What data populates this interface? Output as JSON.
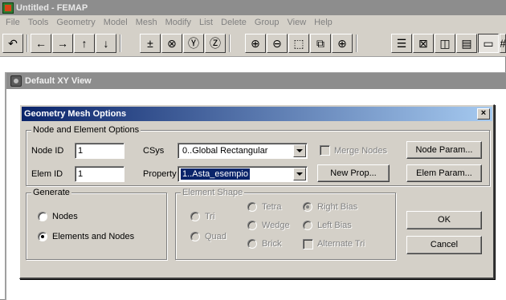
{
  "window": {
    "title": "Untitled - FEMAP"
  },
  "menu": [
    "File",
    "Tools",
    "Geometry",
    "Model",
    "Mesh",
    "Modify",
    "List",
    "Delete",
    "Group",
    "View",
    "Help"
  ],
  "toolbar": {
    "icons": {
      "b0": "↶",
      "b1": "←",
      "b2": "→",
      "b3": "↑",
      "b4": "↓",
      "b5": "±",
      "b6": "⊗",
      "b7": "Ⓨ",
      "b8": "Ⓩ",
      "b9": "⊕",
      "b10": "⊖",
      "b11": "⬚",
      "b12": "⧉",
      "b13": "⊕",
      "b14": "☰",
      "b15": "⊠",
      "b16": "◫",
      "b17": "▤",
      "b18": "▭",
      "b19": "#"
    }
  },
  "view": {
    "title": "Default XY View"
  },
  "dialog": {
    "title": "Geometry Mesh Options",
    "close": "×",
    "node_elem_group": {
      "label": "Node and Element Options",
      "node_id_label": "Node ID",
      "node_id_value": "1",
      "csys_label": "CSys",
      "csys_value": "0..Global Rectangular",
      "merge_nodes_label": "Merge Nodes",
      "node_param_btn": "Node Param...",
      "elem_id_label": "Elem ID",
      "elem_id_value": "1",
      "property_label": "Property",
      "property_value": "1..Asta_esempio",
      "new_prop_btn": "New Prop...",
      "elem_param_btn": "Elem Param..."
    },
    "generate_group": {
      "label": "Generate",
      "nodes": "Nodes",
      "elements_and_nodes": "Elements and Nodes"
    },
    "element_shape_group": {
      "label": "Element Shape",
      "tri": "Tri",
      "quad": "Quad",
      "tetra": "Tetra",
      "wedge": "Wedge",
      "brick": "Brick",
      "right_bias": "Right Bias",
      "left_bias": "Left Bias",
      "alternate_tri": "Alternate Tri"
    },
    "ok_btn": "OK",
    "cancel_btn": "Cancel"
  },
  "colors": {
    "title_gradient_start": "#0a246a",
    "title_gradient_end": "#a6caf0",
    "face": "#d4d0c8"
  }
}
